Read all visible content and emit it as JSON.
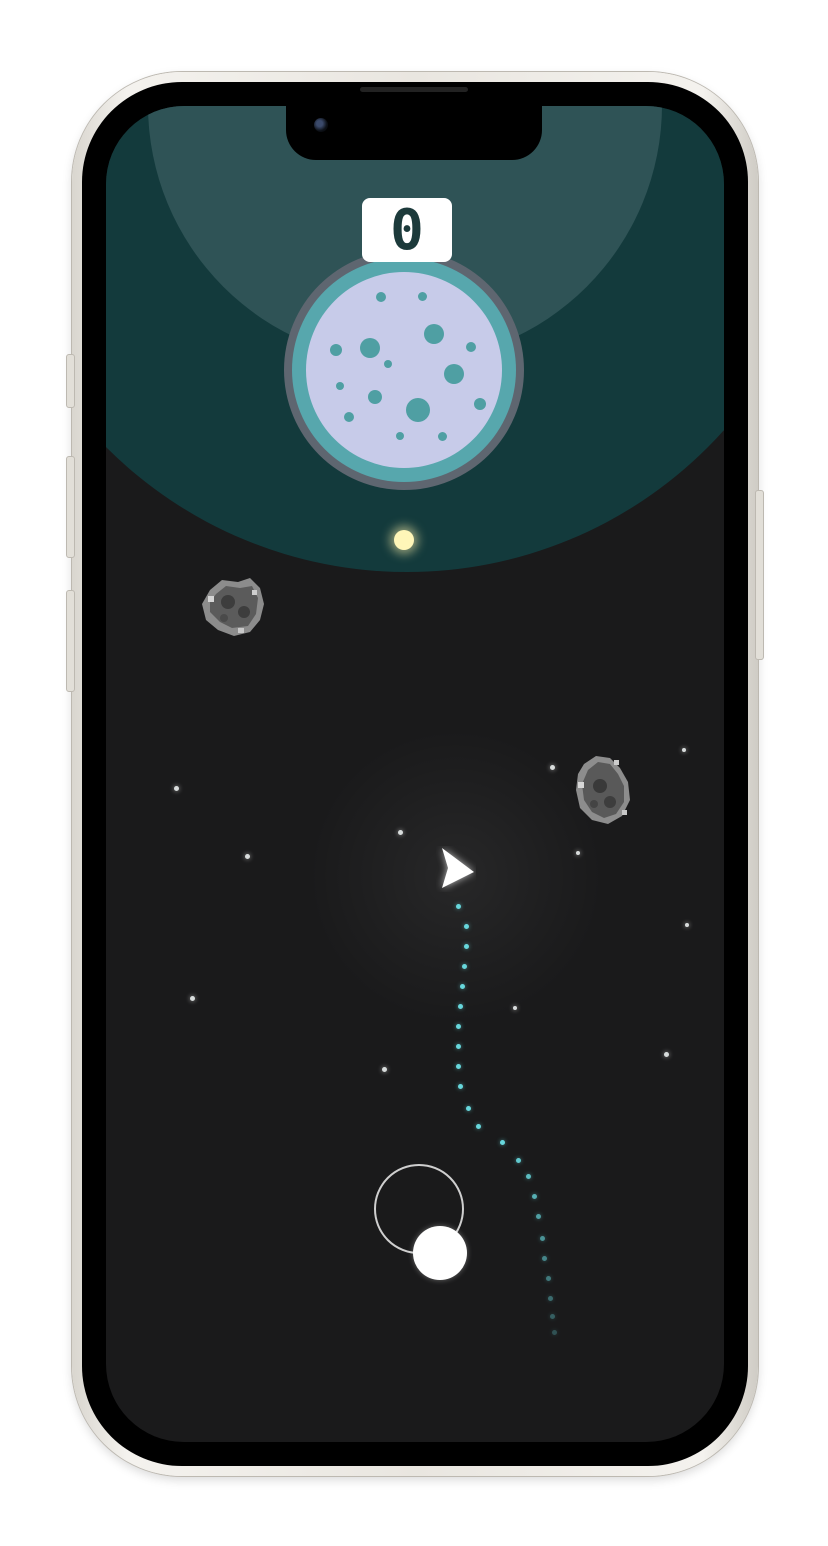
{
  "game": {
    "score": "0",
    "score_label": ""
  },
  "colors": {
    "space_background": "#1a1a1b",
    "atmosphere_outer": "#133a3c",
    "atmosphere_inner": "#2f5356",
    "moon_surface": "#c7cbe9",
    "moon_rim": "#57a7ad",
    "trail": "#67d7dc",
    "ship": "#ffffff"
  },
  "icons": {
    "ship": "triangle-ship-icon",
    "joystick": "virtual-joystick",
    "asteroid": "asteroid-icon",
    "planet": "moon-planet-icon"
  }
}
